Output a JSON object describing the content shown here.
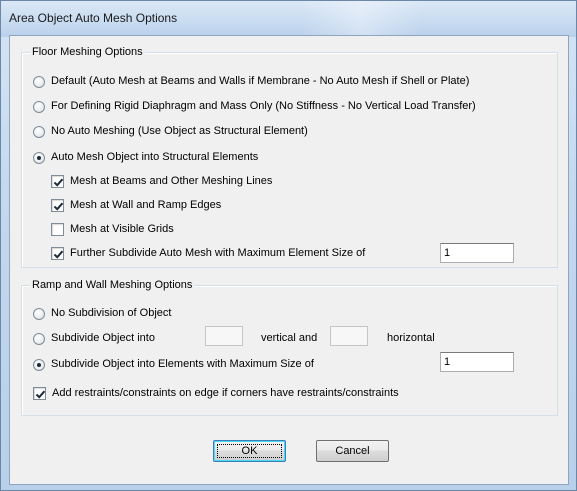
{
  "window": {
    "title": "Area Object Auto Mesh Options"
  },
  "floor": {
    "title": "Floor Meshing Options",
    "options": [
      {
        "label": "Default  (Auto Mesh at Beams and Walls if Membrane - No Auto Mesh if Shell or Plate)",
        "selected": false
      },
      {
        "label": "For Defining Rigid Diaphragm and Mass Only  (No Stiffness - No Vertical Load Transfer)",
        "selected": false
      },
      {
        "label": "No Auto Meshing  (Use Object as Structural Element)",
        "selected": false
      },
      {
        "label": "Auto Mesh Object into Structural Elements",
        "selected": true
      }
    ],
    "checks": [
      {
        "label": "Mesh at Beams and Other Meshing Lines",
        "checked": true
      },
      {
        "label": "Mesh at Wall and Ramp Edges",
        "checked": true
      },
      {
        "label": "Mesh at Visible Grids",
        "checked": false
      },
      {
        "label": "Further Subdivide Auto Mesh with Maximum Element Size of",
        "checked": true
      }
    ],
    "max_size_value": "1"
  },
  "ramp": {
    "title": "Ramp and Wall Meshing Options",
    "opt_none": "No Subdivision of Object",
    "opt_subdivide": "Subdivide Object into",
    "vertical_label": "vertical  and",
    "horizontal_label": "horizontal",
    "vertical_value": "",
    "horizontal_value": "",
    "opt_maxsize": "Subdivide Object into Elements with Maximum Size of",
    "selected_option": 2,
    "max_size_value": "1"
  },
  "restraints": {
    "label": "Add restraints/constraints on edge if corners have restraints/constraints",
    "checked": true
  },
  "buttons": {
    "ok": "OK",
    "cancel": "Cancel"
  }
}
